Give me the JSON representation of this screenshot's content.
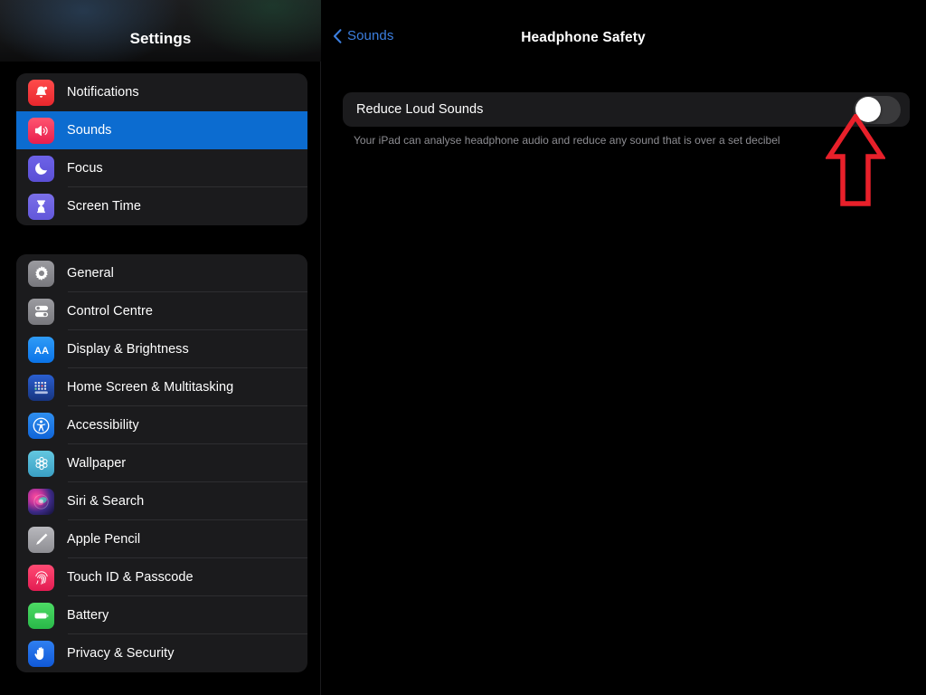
{
  "colors": {
    "accent_blue": "#0c6cd0",
    "link_blue": "#3c7fe0",
    "card_bg": "#1b1b1d",
    "page_bg": "#000000",
    "separator": "#2e2e31",
    "annotation_red": "#e8202a",
    "switch_track_off": "#3a3a3c",
    "switch_knob": "#ffffff",
    "secondary_text": "#8d8d92"
  },
  "sidebar": {
    "title": "Settings",
    "groups": [
      {
        "name": "primary-group",
        "items": [
          {
            "label": "Notifications",
            "icon": "notifications-bell-icon",
            "selected": false
          },
          {
            "label": "Sounds",
            "icon": "sounds-speaker-icon",
            "selected": true
          },
          {
            "label": "Focus",
            "icon": "focus-moon-icon",
            "selected": false
          },
          {
            "label": "Screen Time",
            "icon": "screen-time-hourglass-icon",
            "selected": false
          }
        ]
      },
      {
        "name": "system-group",
        "items": [
          {
            "label": "General",
            "icon": "general-gear-icon",
            "selected": false
          },
          {
            "label": "Control Centre",
            "icon": "control-centre-toggles-icon",
            "selected": false
          },
          {
            "label": "Display & Brightness",
            "icon": "display-brightness-aa-icon",
            "selected": false
          },
          {
            "label": "Home Screen & Multitasking",
            "icon": "home-screen-grid-icon",
            "selected": false
          },
          {
            "label": "Accessibility",
            "icon": "accessibility-person-icon",
            "selected": false
          },
          {
            "label": "Wallpaper",
            "icon": "wallpaper-flower-icon",
            "selected": false
          },
          {
            "label": "Siri & Search",
            "icon": "siri-orb-icon",
            "selected": false
          },
          {
            "label": "Apple Pencil",
            "icon": "apple-pencil-icon",
            "selected": false
          },
          {
            "label": "Touch ID & Passcode",
            "icon": "touch-id-fingerprint-icon",
            "selected": false
          },
          {
            "label": "Battery",
            "icon": "battery-icon",
            "selected": false
          },
          {
            "label": "Privacy & Security",
            "icon": "privacy-hand-icon",
            "selected": false
          }
        ]
      }
    ]
  },
  "detail": {
    "back_label": "Sounds",
    "back_icon": "chevron-left-icon",
    "title": "Headphone Safety",
    "toggle_row": {
      "label": "Reduce Loud Sounds",
      "state": "off"
    },
    "description": "Your iPad can analyse headphone audio and reduce any sound that is over a set decibel"
  },
  "annotation": {
    "type": "arrow-up",
    "points_to": "reduce-loud-sounds-toggle"
  }
}
